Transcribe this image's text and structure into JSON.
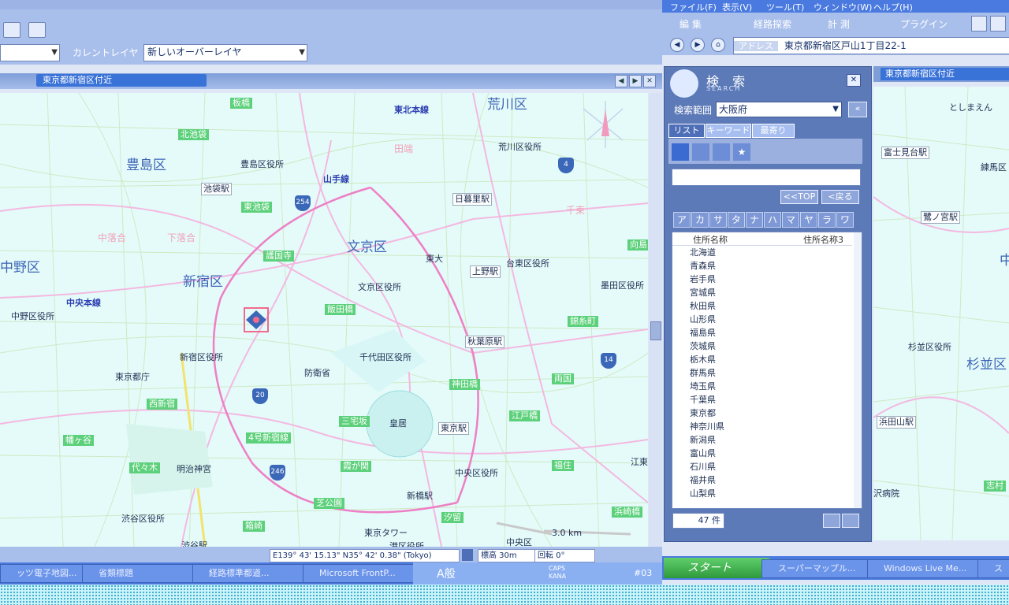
{
  "menu": [
    "ファイル(F)",
    "表示(V)",
    "ツール(T)",
    "ウィンドウ(W)",
    "ヘルプ(H)"
  ],
  "toolbar_right": {
    "edit": "編 集",
    "route": "経路探索",
    "measure": "計 測",
    "plugin": "プラグイン"
  },
  "address": {
    "label": "アドレス",
    "value": "東京都新宿区戸山1丁目22-1"
  },
  "current_layer": {
    "label": "カレントレイヤ",
    "value": "新しいオーバーレイヤ"
  },
  "map_window": {
    "title": "東京都新宿区付近"
  },
  "map_labels": {
    "wards": [
      "豊島区",
      "文京区",
      "新宿区",
      "荒川区",
      "中野区",
      "杉並区"
    ],
    "offices": [
      "豊島区役所",
      "荒川区役所",
      "文京区役所",
      "台東区役所",
      "墨田区役所",
      "新宿区役所",
      "千代田区役所",
      "中野区役所",
      "東京都庁",
      "中央区役所",
      "渋谷区役所"
    ],
    "stations": [
      "池袋駅",
      "日暮里駅",
      "上野駅",
      "秋葉原駅",
      "東京駅",
      "新橋駅",
      "渋谷駅"
    ],
    "railways": [
      "東北本線",
      "山手線",
      "中央本線"
    ],
    "places": [
      "東大",
      "防衛省",
      "皇居",
      "明治神宮",
      "東京タワー",
      "港区役所",
      "江東",
      "中央区"
    ],
    "green": [
      "板橋",
      "北池袋",
      "東池袋",
      "護国寺",
      "飯田橋",
      "神田橋",
      "北の丸",
      "三宅坂",
      "霞が関",
      "西新宿",
      "幡ヶ谷",
      "代々木",
      "4号新宿線",
      "芝公園",
      "浜崎橋",
      "両国",
      "江戸橋",
      "箱崎",
      "福住",
      "汐留",
      "錦糸町",
      "向島"
    ],
    "pink": [
      "田端",
      "下落合",
      "中落合",
      "千束",
      "志村"
    ],
    "routes": [
      "254",
      "4",
      "20",
      "246",
      "14"
    ],
    "scale": "3.0 km"
  },
  "status": {
    "coord": "E139° 43' 15.13\"  N35° 42' 0.38\" (Tokyo)",
    "elevation": "標高 30m",
    "rotation": "回転 0°"
  },
  "search": {
    "title": "検 索",
    "subtitle": "SEARCH",
    "range_label": "検索範囲",
    "range_value": "大阪府",
    "tabs": [
      "リスト",
      "キーワード",
      "最寄り"
    ],
    "top_btn": "<<TOP",
    "back_btn": "<戻る",
    "kana": [
      "ア",
      "カ",
      "サ",
      "タ",
      "ナ",
      "ハ",
      "マ",
      "ヤ",
      "ラ",
      "ワ"
    ],
    "col1": "住所名称",
    "col2": "住所名称3",
    "items": [
      "北海道",
      "青森県",
      "岩手県",
      "宮城県",
      "秋田県",
      "山形県",
      "福島県",
      "茨城県",
      "栃木県",
      "群馬県",
      "埼玉県",
      "千葉県",
      "東京都",
      "神奈川県",
      "新潟県",
      "富山県",
      "石川県",
      "福井県",
      "山梨県"
    ],
    "count": "47 件"
  },
  "right_map": {
    "title": "東京都新宿区付近",
    "labels": [
      "としまえん",
      "富士見台駅",
      "練馬区",
      "鷺ノ宮駅",
      "杉並区役所",
      "杉並区",
      "浜田山駅",
      "中",
      "志村",
      "沢病院",
      "中野区役所",
      "豊島"
    ]
  },
  "taskbar_left": [
    "ッツ電子地図...",
    "省類標題",
    "経路標準都道...",
    "Microsoft FrontP..."
  ],
  "taskbar_right": [
    "スタート",
    "スーパーマップル...",
    "Windows Live Me...",
    "ス"
  ],
  "tray": {
    "ime": "A般",
    "caps": "CAPS KANA",
    "time": "#03"
  }
}
